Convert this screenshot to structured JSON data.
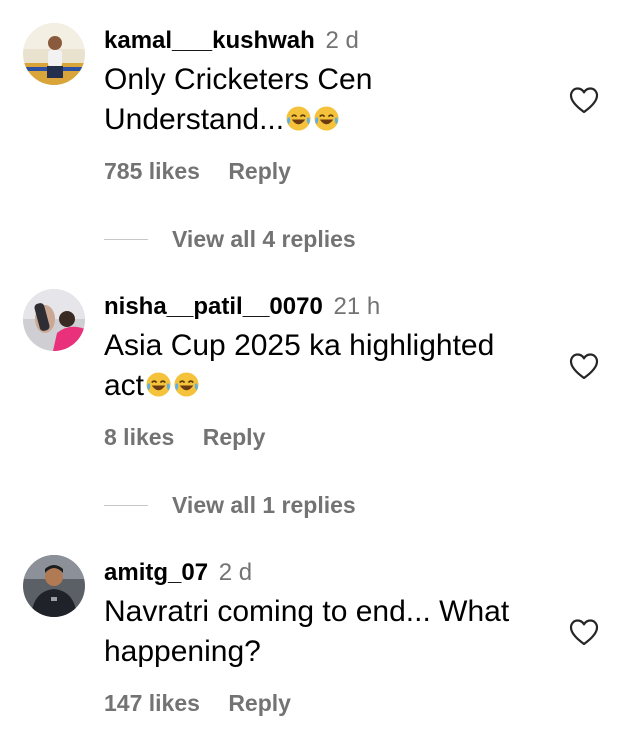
{
  "comments": [
    {
      "username": "kamal___kushwah",
      "time": "2 d",
      "text_line1": "Only Cricketers Cen",
      "text_line2": "Understand...",
      "likes": "785 likes",
      "reply_label": "Reply",
      "view_replies": "View all 4 replies",
      "avatar_icon": "user-avatar-photo"
    },
    {
      "username": "nisha__patil__0070",
      "time": "21 h",
      "text_line1": "Asia Cup 2025 ka highlighted",
      "text_line2": "act",
      "likes": "8 likes",
      "reply_label": "Reply",
      "view_replies": "View all 1 replies",
      "avatar_icon": "user-avatar-photo"
    },
    {
      "username": "amitg_07",
      "time": "2 d",
      "text_line1": "Navratri coming to end... What",
      "text_line2": "happening?",
      "likes": "147 likes",
      "reply_label": "Reply",
      "avatar_icon": "user-avatar-photo"
    }
  ],
  "icons": {
    "like": "heart-outline-icon",
    "emoji": "face-with-tears-of-joy-icon"
  },
  "colors": {
    "secondary_text": "#737373",
    "divider": "#c7c7c7",
    "emoji_yellow": "#f5c33b"
  }
}
